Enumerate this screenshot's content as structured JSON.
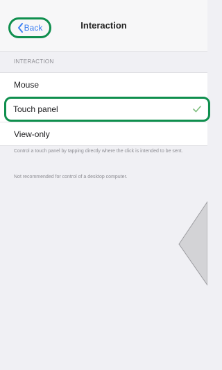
{
  "nav": {
    "back_label": "Back",
    "title": "Interaction"
  },
  "section": {
    "header": "INTERACTION"
  },
  "options": [
    {
      "label": "Mouse",
      "selected": false
    },
    {
      "label": "Touch panel",
      "selected": true
    },
    {
      "label": "View-only",
      "selected": false
    }
  ],
  "footer": {
    "line1": "Control a touch panel by tapping directly where the click is intended to be sent.",
    "line2": "Not recommended for control of a desktop computer."
  },
  "colors": {
    "accent_blue": "#3b7ff2",
    "highlight_green": "#0f8f4e",
    "check_green": "#7fbf7f"
  }
}
